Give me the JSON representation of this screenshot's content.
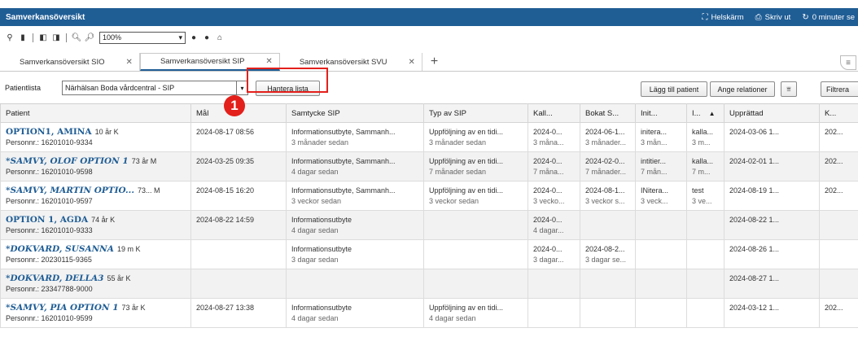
{
  "window": {
    "title": "Samverkansöversikt"
  },
  "title_actions": [
    {
      "icon": "fullscreen-icon",
      "label": "Helskärm"
    },
    {
      "icon": "printer-icon",
      "label": "Skriv ut"
    },
    {
      "icon": "refresh-icon",
      "label": "0 minuter se"
    }
  ],
  "toolbar": {
    "zoom": "100%"
  },
  "tabs": [
    {
      "label": "Samverkansöversikt SIO",
      "active": false
    },
    {
      "label": "Samverkansöversikt SIP",
      "active": true
    },
    {
      "label": "Samverkansöversikt SVU",
      "active": false
    }
  ],
  "listbar": {
    "label": "Patientlista",
    "selected": "Närhälsan Boda vårdcentral - SIP",
    "manage_button": "Hantera lista",
    "add_patient": "Lägg till patient",
    "relations": "Ange relationer",
    "filter": "Filtrera"
  },
  "annotation": {
    "number": "1"
  },
  "table": {
    "columns": [
      "Patient",
      "Mål",
      "Samtycke SIP",
      "Typ av SIP",
      "Kall...",
      "Bokat S...",
      "Init...",
      "I...",
      "Upprättad",
      "K..."
    ],
    "rows": [
      {
        "name": "OPTION1, AMINA",
        "italic": false,
        "meta": "10 år  K",
        "pnr": "Personnr.: 16201010-9334",
        "c1": "2024-08-17 08:56",
        "c1s": "",
        "c2": "Informationsutbyte, Sammanh...",
        "c2s": "3 månader sedan",
        "c3": "Uppföljning av en tidi...",
        "c3s": "3 månader sedan",
        "c4": "2024-0...",
        "c4s": "3 måna...",
        "c5": "2024-06-1...",
        "c5s": "3 månader...",
        "c6": "initera...",
        "c6s": "3 mån...",
        "c7": "kalla...",
        "c7s": "3 m...",
        "c8": "2024-03-06 1...",
        "c9": "202..."
      },
      {
        "name": "*SAMVY, OLOF OPTION 1",
        "italic": true,
        "meta": "73 år  M",
        "pnr": "Personnr.: 16201010-9598",
        "c1": "2024-03-25 09:35",
        "c1s": "",
        "c2": "Informationsutbyte, Sammanh...",
        "c2s": "4 dagar sedan",
        "c3": "Uppföljning av en tidi...",
        "c3s": "7 månader sedan",
        "c4": "2024-0...",
        "c4s": "7 måna...",
        "c5": "2024-02-0...",
        "c5s": "7 månader...",
        "c6": "intitier...",
        "c6s": "7 mån...",
        "c7": "kalla...",
        "c7s": "7 m...",
        "c8": "2024-02-01 1...",
        "c9": "202..."
      },
      {
        "name": "*SAMVY, MARTIN OPTIO...",
        "italic": true,
        "meta": "73...  M",
        "pnr": "Personnr.: 16201010-9597",
        "c1": "2024-08-15 16:20",
        "c1s": "",
        "c2": "Informationsutbyte, Sammanh...",
        "c2s": "3 veckor sedan",
        "c3": "Uppföljning av en tidi...",
        "c3s": "3 veckor sedan",
        "c4": "2024-0...",
        "c4s": "3 vecko...",
        "c5": "2024-08-1...",
        "c5s": "3 veckor s...",
        "c6": "INitera...",
        "c6s": "3 veck...",
        "c7": "test",
        "c7s": "3 ve...",
        "c8": "2024-08-19 1...",
        "c9": "202..."
      },
      {
        "name": "OPTION 1, AGDA",
        "italic": false,
        "meta": "74 år  K",
        "pnr": "Personnr.: 16201010-9333",
        "c1": "2024-08-22 14:59",
        "c1s": "",
        "c2": "Informationsutbyte",
        "c2s": "4 dagar sedan",
        "c3": "",
        "c3s": "",
        "c4": "2024-0...",
        "c4s": "4 dagar...",
        "c5": "",
        "c5s": "",
        "c6": "",
        "c6s": "",
        "c7": "",
        "c7s": "",
        "c8": "2024-08-22 1...",
        "c9": ""
      },
      {
        "name": "*DOKVARD, SUSANNA",
        "italic": true,
        "meta": "19 m  K",
        "pnr": "Personnr.: 20230115-9365",
        "c1": "",
        "c1s": "",
        "c2": "Informationsutbyte",
        "c2s": "3 dagar sedan",
        "c3": "",
        "c3s": "",
        "c4": "2024-0...",
        "c4s": "3 dagar...",
        "c5": "2024-08-2...",
        "c5s": "3 dagar se...",
        "c6": "",
        "c6s": "",
        "c7": "",
        "c7s": "",
        "c8": "2024-08-26 1...",
        "c9": ""
      },
      {
        "name": "*DOKVARD, DELLA3",
        "italic": true,
        "meta": "55 år  K",
        "pnr": "Personnr.: 23347788-9000",
        "c1": "",
        "c1s": "",
        "c2": "",
        "c2s": "",
        "c3": "",
        "c3s": "",
        "c4": "",
        "c4s": "",
        "c5": "",
        "c5s": "",
        "c6": "",
        "c6s": "",
        "c7": "",
        "c7s": "",
        "c8": "2024-08-27 1...",
        "c9": ""
      },
      {
        "name": "*SAMVY, PIA OPTION 1",
        "italic": true,
        "meta": "73 år  K",
        "pnr": "Personnr.: 16201010-9599",
        "c1": "2024-08-27 13:38",
        "c1s": "",
        "c2": "Informationsutbyte",
        "c2s": "4 dagar sedan",
        "c3": "Uppföljning av en tidi...",
        "c3s": "4 dagar sedan",
        "c4": "",
        "c4s": "",
        "c5": "",
        "c5s": "",
        "c6": "",
        "c6s": "",
        "c7": "",
        "c7s": "",
        "c8": "2024-03-12 1...",
        "c9": "202..."
      }
    ]
  },
  "colors": {
    "header_blue": "#1f5d95",
    "annotation_red": "#e3201b",
    "row_alt": "#f2f2f2"
  }
}
